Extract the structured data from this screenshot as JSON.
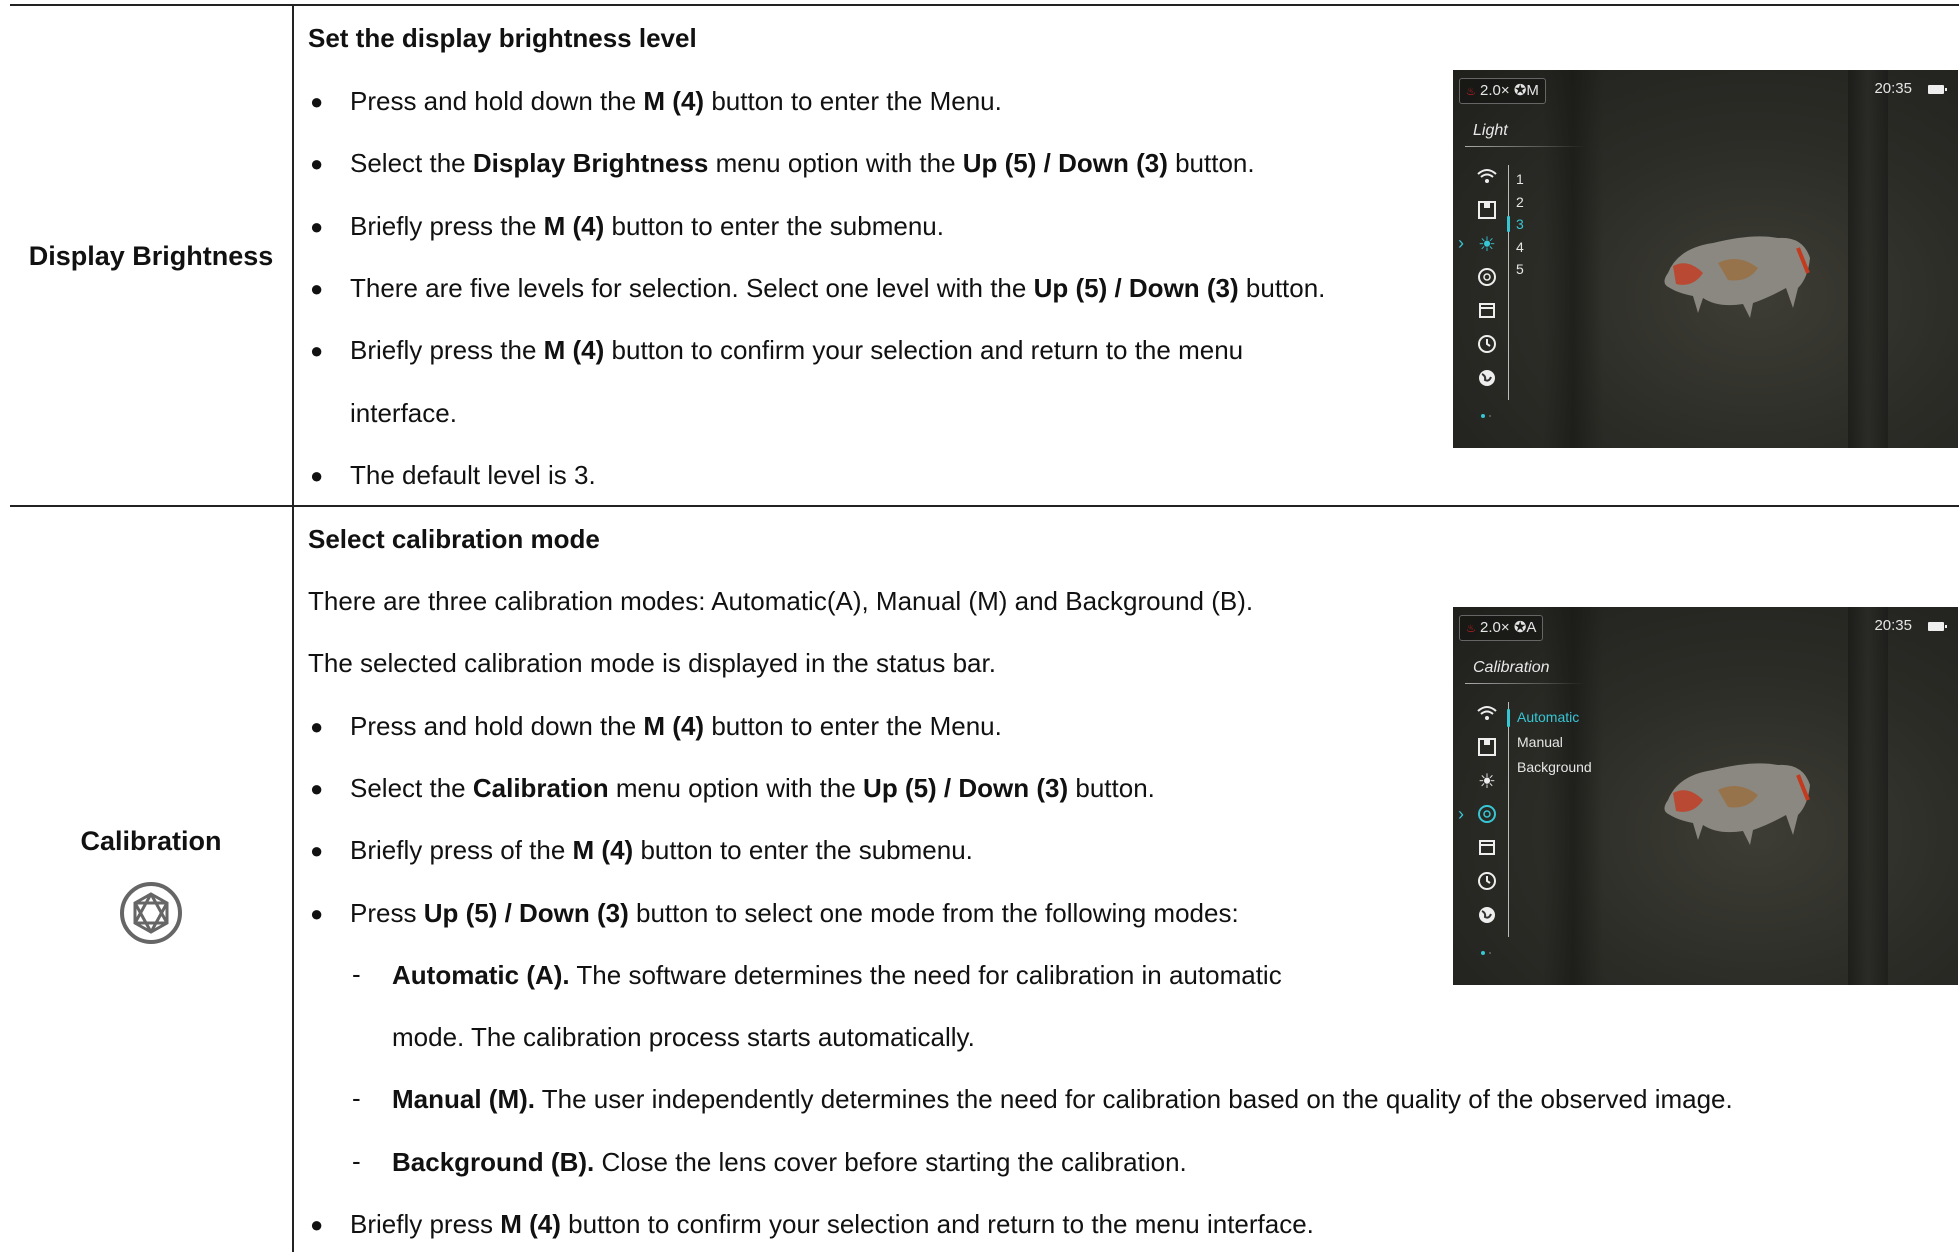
{
  "rows": [
    {
      "label": "Display Brightness",
      "heading": "Set the display brightness level",
      "lines": [
        {
          "type": "bullet",
          "parts": [
            [
              "n",
              "Press and hold down the "
            ],
            [
              "b",
              "M (4)"
            ],
            [
              "n",
              " button to enter the Menu."
            ]
          ]
        },
        {
          "type": "bullet",
          "parts": [
            [
              "n",
              "Select the "
            ],
            [
              "b",
              "Display Brightness"
            ],
            [
              "n",
              " menu option with the "
            ],
            [
              "b",
              "Up (5) / Down (3)"
            ],
            [
              "n",
              " button."
            ]
          ]
        },
        {
          "type": "bullet",
          "parts": [
            [
              "n",
              "Briefly press the "
            ],
            [
              "b",
              "M (4)"
            ],
            [
              "n",
              " button to enter the submenu."
            ]
          ]
        },
        {
          "type": "bullet",
          "parts": [
            [
              "n",
              "There are five levels for selection. Select one level with the "
            ],
            [
              "b",
              "Up (5) / Down (3)"
            ],
            [
              "n",
              " button."
            ]
          ]
        },
        {
          "type": "bullet",
          "parts": [
            [
              "n",
              "Briefly press the "
            ],
            [
              "b",
              "M (4)"
            ],
            [
              "n",
              " button to confirm your selection and return to the menu"
            ]
          ]
        },
        {
          "type": "cont",
          "parts": [
            [
              "n",
              "interface."
            ]
          ]
        },
        {
          "type": "bullet",
          "parts": [
            [
              "n",
              "The default level is 3."
            ]
          ]
        }
      ],
      "screen": {
        "zoom": "2.0×",
        "mode": "M",
        "time": "20:35",
        "menu_title": "Light",
        "options": [
          "1",
          "2",
          "3",
          "4",
          "5"
        ],
        "selected_option": "3",
        "selected_icon": "brightness-icon"
      }
    },
    {
      "label": "Calibration",
      "heading": "Select calibration mode",
      "lines": [
        {
          "type": "plain",
          "parts": [
            [
              "n",
              "There are three calibration modes: Automatic(A), Manual (M) and Background (B)."
            ]
          ]
        },
        {
          "type": "plain",
          "parts": [
            [
              "n",
              "The selected calibration mode is displayed in the status bar."
            ]
          ]
        },
        {
          "type": "bullet",
          "parts": [
            [
              "n",
              "Press and hold down the "
            ],
            [
              "b",
              "M (4)"
            ],
            [
              "n",
              " button to enter the Menu."
            ]
          ]
        },
        {
          "type": "bullet",
          "parts": [
            [
              "n",
              "Select the "
            ],
            [
              "b",
              "Calibration"
            ],
            [
              "n",
              " menu option with the "
            ],
            [
              "b",
              "Up (5) / Down (3)"
            ],
            [
              "n",
              " button."
            ]
          ]
        },
        {
          "type": "bullet",
          "parts": [
            [
              "n",
              "Briefly press of the "
            ],
            [
              "b",
              "M (4)"
            ],
            [
              "n",
              " button to enter the submenu."
            ]
          ]
        },
        {
          "type": "bullet",
          "parts": [
            [
              "n",
              "Press "
            ],
            [
              "b",
              "Up (5) / Down (3)"
            ],
            [
              "n",
              " button to select one mode from the following modes:"
            ]
          ]
        },
        {
          "type": "dash",
          "parts": [
            [
              "b",
              "Automatic (A)."
            ],
            [
              "n",
              " The software determines the need for calibration in automatic"
            ]
          ]
        },
        {
          "type": "dashcont",
          "parts": [
            [
              "n",
              "mode. The calibration process starts automatically."
            ]
          ]
        },
        {
          "type": "dash",
          "parts": [
            [
              "b",
              "Manual (M)."
            ],
            [
              "n",
              " The user independently determines the need for calibration based on the quality of the observed image."
            ]
          ]
        },
        {
          "type": "dash",
          "parts": [
            [
              "b",
              "Background (B)."
            ],
            [
              "n",
              " Close the lens cover before starting the calibration."
            ]
          ]
        },
        {
          "type": "bullet",
          "parts": [
            [
              "n",
              "Briefly press "
            ],
            [
              "b",
              "M (4)"
            ],
            [
              "n",
              " button to confirm your selection and return to the menu interface."
            ]
          ]
        }
      ],
      "screen": {
        "zoom": "2.0×",
        "mode": "A",
        "time": "20:35",
        "menu_title": "Calibration",
        "options": [
          "Automatic",
          "Manual",
          "Background"
        ],
        "selected_option": "Automatic",
        "selected_icon": "aperture-icon"
      }
    }
  ],
  "bullet_glyph": "●",
  "dash_glyph": "-"
}
